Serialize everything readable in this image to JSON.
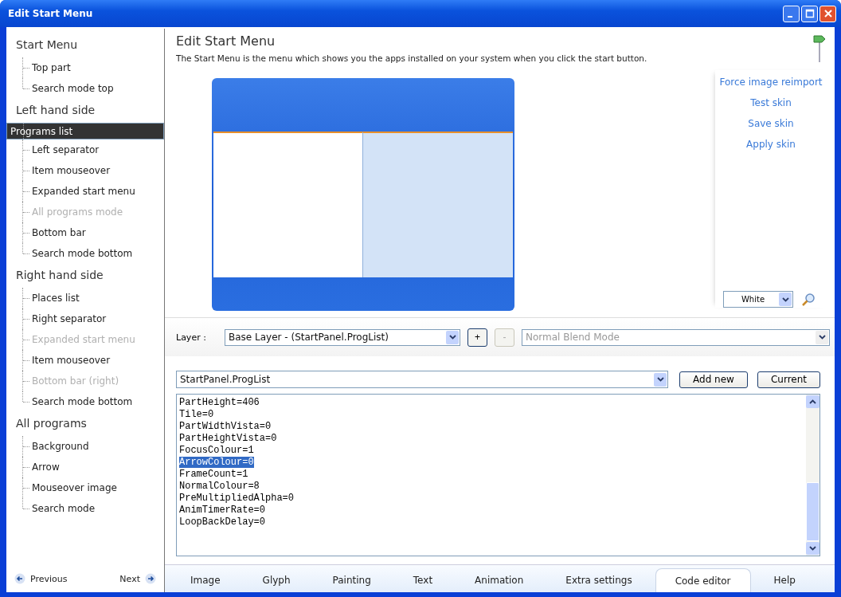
{
  "window": {
    "title": "Edit Start Menu"
  },
  "sidebar": {
    "groups": [
      {
        "title": "Start Menu",
        "items": [
          {
            "label": "Top part",
            "selected": false,
            "disabled": false
          },
          {
            "label": "Search mode top",
            "selected": false,
            "disabled": false
          }
        ]
      },
      {
        "title": "Left hand side",
        "items": [
          {
            "label": "Programs list",
            "selected": true,
            "disabled": false
          },
          {
            "label": "Left separator",
            "selected": false,
            "disabled": false
          },
          {
            "label": "Item mouseover",
            "selected": false,
            "disabled": false
          },
          {
            "label": "Expanded start menu",
            "selected": false,
            "disabled": false
          },
          {
            "label": "All programs mode",
            "selected": false,
            "disabled": true
          },
          {
            "label": "Bottom bar",
            "selected": false,
            "disabled": false
          },
          {
            "label": "Search mode bottom",
            "selected": false,
            "disabled": false
          }
        ]
      },
      {
        "title": "Right hand side",
        "items": [
          {
            "label": "Places list",
            "selected": false,
            "disabled": false
          },
          {
            "label": "Right separator",
            "selected": false,
            "disabled": false
          },
          {
            "label": "Expanded start menu",
            "selected": false,
            "disabled": true
          },
          {
            "label": "Item mouseover",
            "selected": false,
            "disabled": false
          },
          {
            "label": "Bottom bar (right)",
            "selected": false,
            "disabled": true
          },
          {
            "label": "Search mode bottom",
            "selected": false,
            "disabled": false
          }
        ]
      },
      {
        "title": "All programs",
        "items": [
          {
            "label": "Background",
            "selected": false,
            "disabled": false
          },
          {
            "label": "Arrow",
            "selected": false,
            "disabled": false
          },
          {
            "label": "Mouseover image",
            "selected": false,
            "disabled": false
          },
          {
            "label": "Search mode",
            "selected": false,
            "disabled": false
          }
        ]
      }
    ],
    "previous": "Previous",
    "next": "Next"
  },
  "header": {
    "title": "Edit Start Menu",
    "description": "The Start Menu is the menu which shows you the apps installed on your system when you click the start button."
  },
  "actions": [
    "Force image reimport",
    "Test skin",
    "Save skin",
    "Apply skin"
  ],
  "background_select": {
    "value": "White"
  },
  "layer": {
    "label": "Layer :",
    "value": "Base Layer - (StartPanel.ProgList)",
    "add": "+",
    "remove": "-",
    "remove_disabled": true,
    "blend_mode": "Normal Blend Mode",
    "blend_disabled": true
  },
  "section_select": {
    "value": "StartPanel.ProgList"
  },
  "buttons": [
    "Add new",
    "Current"
  ],
  "code": {
    "lines": [
      {
        "text": "PartHeight=406",
        "selected": false
      },
      {
        "text": "Tile=0",
        "selected": false
      },
      {
        "text": "PartWidthVista=0",
        "selected": false
      },
      {
        "text": "PartHeightVista=0",
        "selected": false
      },
      {
        "text": "FocusColour=1",
        "selected": false
      },
      {
        "text": "ArrowColour=0",
        "selected": true
      },
      {
        "text": "FrameCount=1",
        "selected": false
      },
      {
        "text": "NormalColour=8",
        "selected": false
      },
      {
        "text": "PreMultipliedAlpha=0",
        "selected": false
      },
      {
        "text": "AnimTimerRate=0",
        "selected": false
      },
      {
        "text": "LoopBackDelay=0",
        "selected": false
      }
    ]
  },
  "tabs": [
    {
      "label": "Image",
      "selected": false
    },
    {
      "label": "Glyph",
      "selected": false
    },
    {
      "label": "Painting",
      "selected": false
    },
    {
      "label": "Text",
      "selected": false
    },
    {
      "label": "Animation",
      "selected": false
    },
    {
      "label": "Extra settings",
      "selected": false
    },
    {
      "label": "Code editor",
      "selected": true
    },
    {
      "label": "Help",
      "selected": false
    }
  ]
}
